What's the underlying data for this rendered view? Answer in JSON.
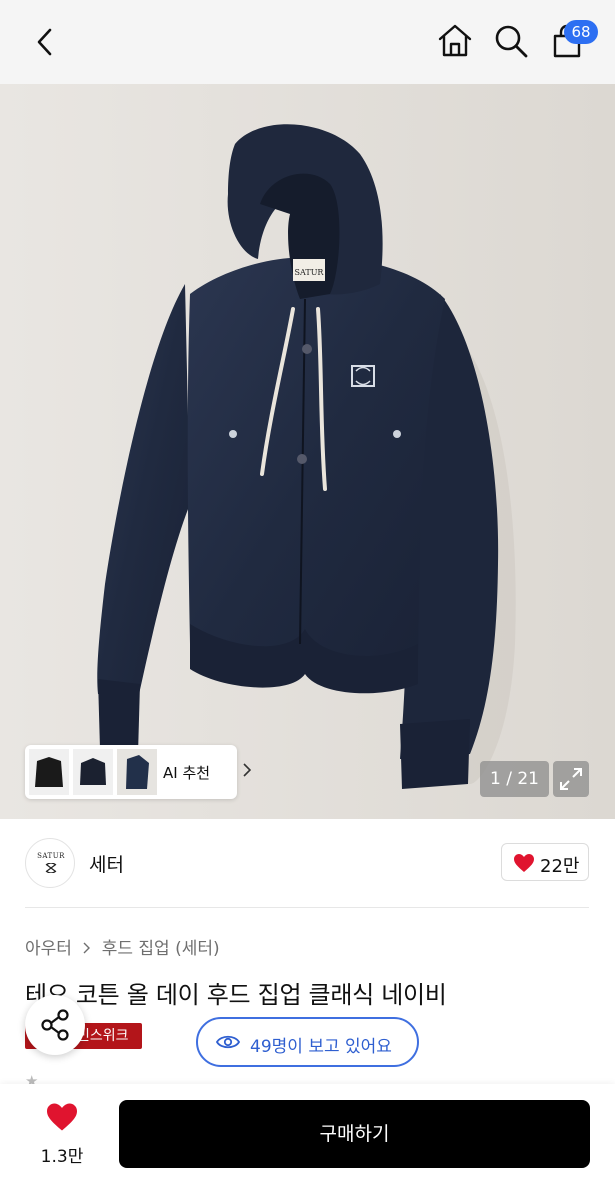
{
  "header": {
    "cart_count": "68",
    "icons": [
      "back-icon",
      "home-icon",
      "search-icon",
      "shopping-bag-icon"
    ]
  },
  "gallery": {
    "counter": "1 / 21",
    "ai_recommend_label": "AI 추천",
    "logo_text": "SATUR"
  },
  "brand": {
    "logo_text": "SATUR",
    "name": "세터",
    "likes": "22만"
  },
  "breadcrumb": [
    "아우터",
    "후드 집업 (세터)"
  ],
  "product": {
    "title": "테오 코튼 올 데이 후드 집업 클래식 네이비",
    "tag": "빈스위크"
  },
  "viewers": {
    "text": "49명이 보고 있어요"
  },
  "bottom": {
    "wish_count": "1.3만",
    "buy_label": "구매하기"
  },
  "colors": {
    "accent_blue": "#3f6fe0",
    "badge_blue": "#2d6ff2",
    "heart_red": "#e0142f",
    "tag_red": "#b3151a",
    "buy_button": "#000000"
  }
}
